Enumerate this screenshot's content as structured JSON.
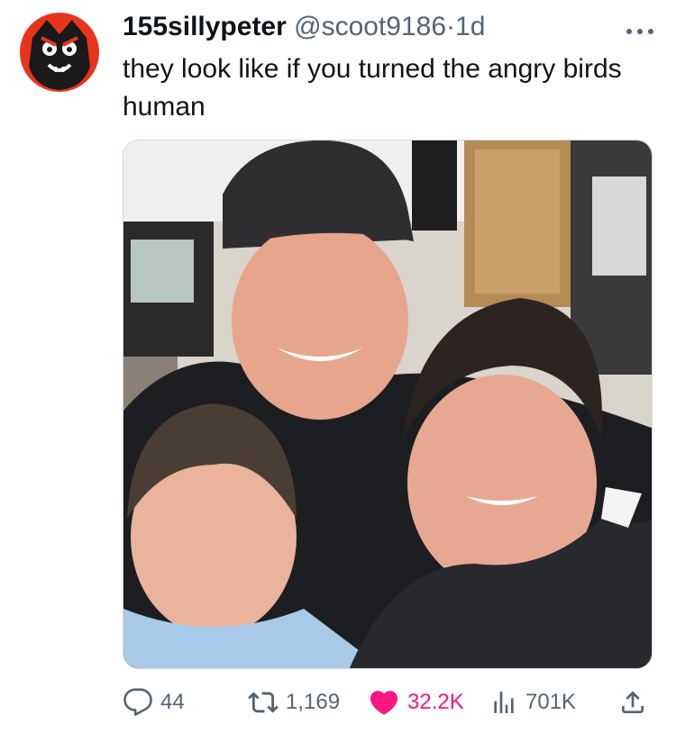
{
  "tweet": {
    "display_name": "155sillypeter",
    "handle": "@scoot9186",
    "separator": "·",
    "time": "1d",
    "text": "they look like if you turned the angry birds human"
  },
  "icons": {
    "avatar": "angry-cartoon-face-avatar",
    "more": "more-dots-icon",
    "reply": "reply-bubble-icon",
    "retweet": "retweet-icon",
    "like": "heart-icon",
    "views": "views-bars-icon",
    "share": "share-upload-icon"
  },
  "media": {
    "description_icon": "photo"
  },
  "actions": {
    "reply_count": "44",
    "retweet_count": "1,169",
    "like_count": "32.2K",
    "view_count": "701K"
  },
  "colors": {
    "text": "#0f1419",
    "secondary": "#536471",
    "like": "#f91880",
    "avatar_bg": "#e8341c"
  }
}
